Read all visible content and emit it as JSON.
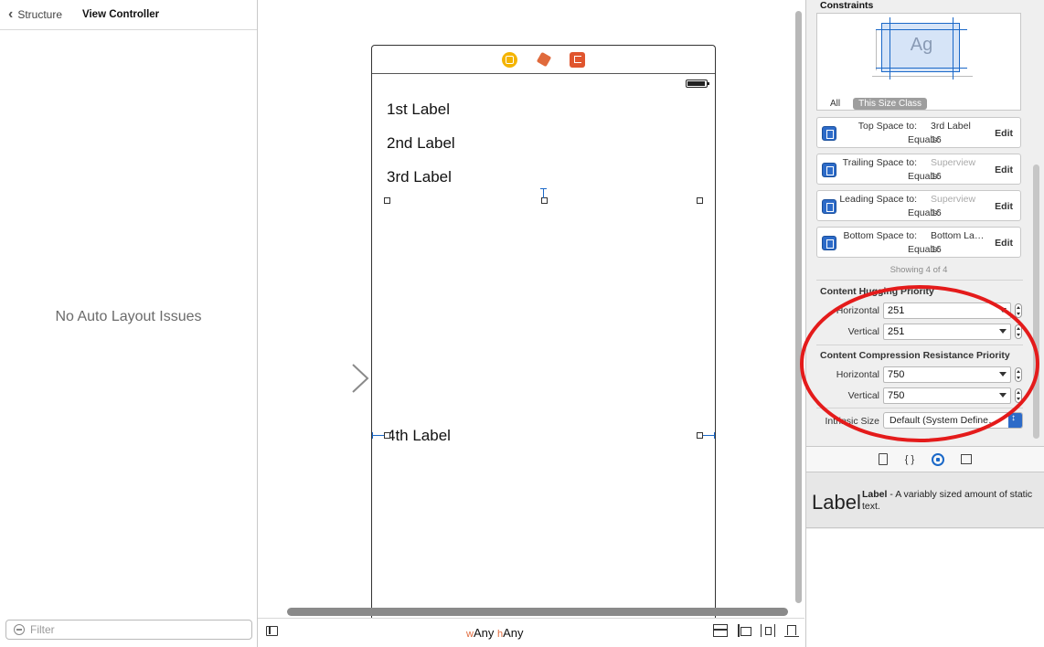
{
  "outline": {
    "back_label": "Structure",
    "title": "View Controller",
    "empty_message": "No Auto Layout Issues",
    "filter_placeholder": "Filter"
  },
  "canvas": {
    "labels": [
      "1st Label",
      "2nd Label",
      "3rd Label",
      "4th Label"
    ],
    "size_class": {
      "w_prefix": "w",
      "w_value": "Any",
      "h_prefix": "h",
      "h_value": "Any"
    }
  },
  "inspector": {
    "constraints_title": "Constraints",
    "preview_text": "Ag",
    "tab_all": "All",
    "tab_size_class": "This Size Class",
    "constraints": [
      {
        "key": "Top Space to:",
        "target": "3rd Label",
        "target_muted": false,
        "equals_label": "Equals:",
        "value": "16",
        "action": "Edit"
      },
      {
        "key": "Trailing Space to:",
        "target": "Superview",
        "target_muted": true,
        "equals_label": "Equals:",
        "value": "16",
        "action": "Edit"
      },
      {
        "key": "Leading Space to:",
        "target": "Superview",
        "target_muted": true,
        "equals_label": "Equals:",
        "value": "16",
        "action": "Edit"
      },
      {
        "key": "Bottom Space to:",
        "target": "Bottom La…",
        "target_muted": false,
        "equals_label": "Equals:",
        "value": "16",
        "action": "Edit"
      }
    ],
    "showing": "Showing 4 of 4",
    "hugging": {
      "title": "Content Hugging Priority",
      "horizontal_label": "Horizontal",
      "horizontal_value": "251",
      "vertical_label": "Vertical",
      "vertical_value": "251"
    },
    "compression": {
      "title": "Content Compression Resistance Priority",
      "horizontal_label": "Horizontal",
      "horizontal_value": "750",
      "vertical_label": "Vertical",
      "vertical_value": "750"
    },
    "intrinsic": {
      "label": "Intrinsic Size",
      "value": "Default (System Define…"
    },
    "library": {
      "icon_text": "Label",
      "name": "Label",
      "description": " - A variably sized amount of static text."
    }
  },
  "colors": {
    "accent": "#1a68c8",
    "annotation": "#e41b1b",
    "vc_icon": "#f4b400",
    "exit_icon": "#e0552e"
  },
  "icons": [
    "back-chevron-icon",
    "filter-icon",
    "view-controller-icon",
    "first-responder-icon",
    "exit-icon",
    "battery-icon",
    "entry-arrow-icon",
    "sidebar-toggle-icon",
    "embed-stack-icon",
    "align-icon",
    "pin-icon",
    "resolve-issues-icon",
    "constraint-icon",
    "file-template-icon",
    "code-snippet-icon",
    "object-library-icon",
    "media-library-icon"
  ]
}
